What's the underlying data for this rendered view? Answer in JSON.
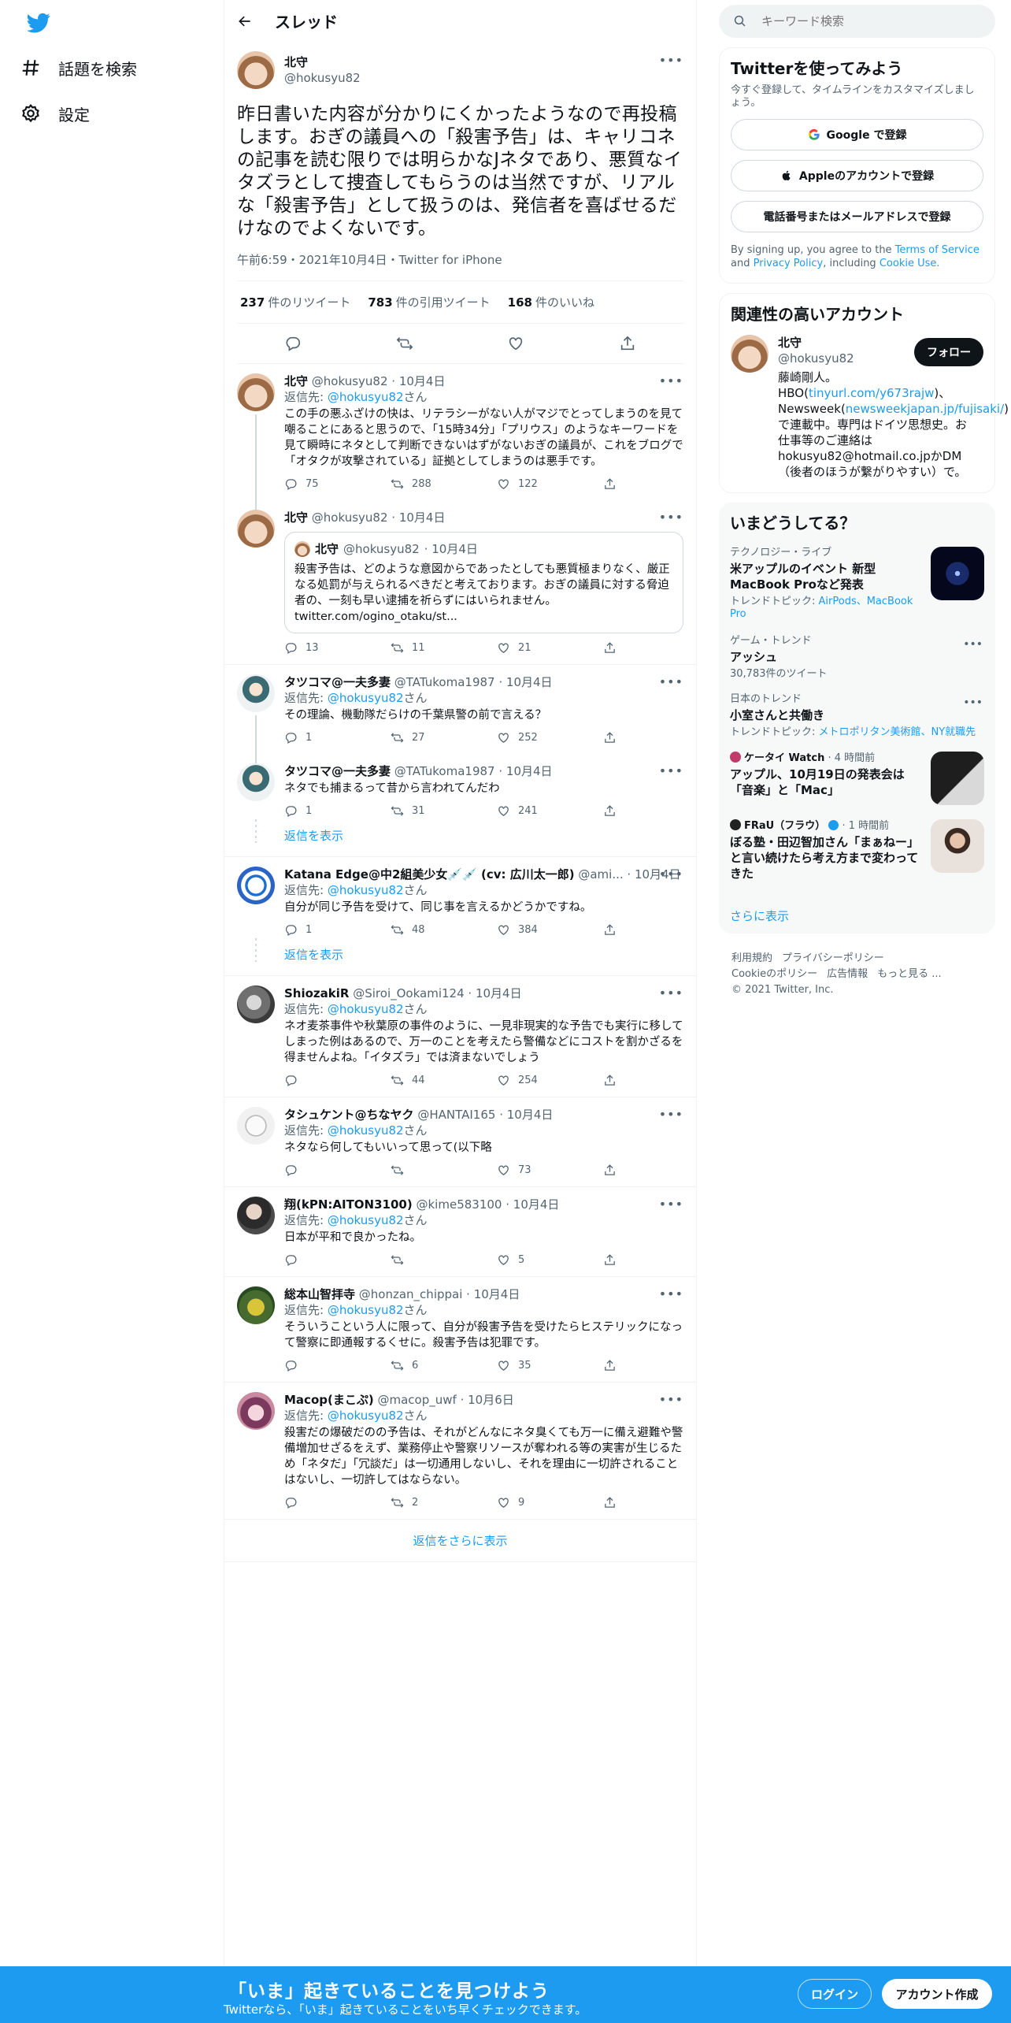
{
  "nav": {
    "explore_label": "話題を検索",
    "settings_label": "設定"
  },
  "header": {
    "title": "スレッド"
  },
  "focus": {
    "name": "北守",
    "handle": "@hokusyu82",
    "text": "昨日書いた内容が分かりにくかったようなので再投稿します。おぎの議員への「殺害予告」は、キャリコネの記事を読む限りでは明らかなJネタであり、悪質なイタズラとして捜査してもらうのは当然ですが、リアルな「殺害予告」として扱うのは、発信者を喜ばせるだけなのでよくないです。",
    "meta": "午前6:59・2021年10月4日・Twitter for iPhone",
    "retweets": "237",
    "retweets_label": "件のリツイート",
    "quotes": "783",
    "quotes_label": "件の引用ツイート",
    "likes": "168",
    "likes_label": "件のいいね"
  },
  "reply_prefix": "返信先:",
  "reply_target": "@hokusyu82",
  "reply_suffix": "さん",
  "tweets": [
    {
      "name": "北守",
      "handle": "@hokusyu82",
      "date": "10月4日",
      "has_reply": true,
      "text": "この手の悪ふざけの快は、リテラシーがない人がマジでとってしまうのを見て嘲ることにあると思うので、「15時34分」「プリウス」のようなキーワードを見て瞬時にネタとして判断できないはずがないおぎの議員が、これをブログで「オタクが攻撃されている」証拠としてしまうのは悪手です。",
      "replies": "75",
      "retweets": "288",
      "likes": "122"
    },
    {
      "name": "北守",
      "handle": "@hokusyu82",
      "date": "10月4日",
      "has_reply": false,
      "quote": {
        "name": "北守",
        "handle": "@hokusyu82",
        "date": "· 10月4日",
        "text": "殺害予告は、どのような意図からであったとしても悪質極まりなく、厳正なる処罰が与えられるべきだと考えております。おぎの議員に対する脅迫者の、一刻も早い逮捕を祈らずにはいられません。",
        "link": "twitter.com/ogino_otaku/st..."
      },
      "replies": "13",
      "retweets": "11",
      "likes": "21"
    },
    {
      "name": "タツコマ@一夫多妻",
      "handle": "@TATukoma1987",
      "date": "10月4日",
      "has_reply": true,
      "text": "その理論、機動隊だらけの千葉県警の前で言える？",
      "replies": "1",
      "retweets": "27",
      "likes": "252"
    },
    {
      "name": "タツコマ@一夫多妻",
      "handle": "@TATukoma1987",
      "date": "10月4日",
      "has_reply": false,
      "text": "ネタでも捕まるって昔から言われてんだわ",
      "replies": "1",
      "retweets": "31",
      "likes": "241"
    },
    {
      "name": "Katana Edge@中2組美少女💉💉 (cv: 広川太一郎)",
      "handle": "@ami...",
      "date": "10月4日",
      "has_reply": true,
      "text": "自分が同じ予告を受けて、同じ事を言えるかどうかですね。",
      "replies": "1",
      "retweets": "48",
      "likes": "384"
    },
    {
      "name": "ShiozakiR",
      "handle": "@Siroi_Ookami124",
      "date": "10月4日",
      "has_reply": true,
      "text": "ネオ麦茶事件や秋葉原の事件のように、一見非現実的な予告でも実行に移してしまった例はあるので、万一のことを考えたら警備などにコストを割かざるを得ませんよね。「イタズラ」では済まないでしょう",
      "replies": "",
      "retweets": "44",
      "likes": "254"
    },
    {
      "name": "タシュケント@ちなヤク",
      "handle": "@HANTAI165",
      "date": "10月4日",
      "has_reply": true,
      "text": "ネタなら何してもいいって思って(以下略",
      "replies": "",
      "retweets": "",
      "likes": "73"
    },
    {
      "name": "翔(kPN:AITON3100)",
      "handle": "@kime583100",
      "date": "10月4日",
      "has_reply": true,
      "text": "日本が平和で良かったね。",
      "replies": "",
      "retweets": "",
      "likes": "5"
    },
    {
      "name": "総本山智拝寺",
      "handle": "@honzan_chippai",
      "date": "10月4日",
      "has_reply": true,
      "text": "そういうこという人に限って、自分が殺害予告を受けたらヒステリックになって警察に即通報するくせに。殺害予告は犯罪です。",
      "replies": "",
      "retweets": "6",
      "likes": "35"
    },
    {
      "name": "Macop(まこぷ)",
      "handle": "@macop_uwf",
      "date": "10月6日",
      "has_reply": true,
      "text": "殺害だの爆破だのの予告は、それがどんなにネタ臭くても万一に備え避難や警備増加せざるをえず、業務停止や警察リソースが奪われる等の実害が生じるため「ネタだ」「冗談だ」は一切通用しないし、それを理由に一切許されることはないし、一切許してはならない。",
      "replies": "",
      "retweets": "2",
      "likes": "9"
    }
  ],
  "show_replies_label": "返信を表示",
  "show_more_replies": "返信をさらに表示",
  "sidebar": {
    "search_placeholder": "キーワード検索",
    "signup": {
      "title": "Twitterを使ってみよう",
      "subtitle": "今すぐ登録して、タイムラインをカスタマイズしましょう。",
      "google": "Google で登録",
      "apple": "Appleのアカウントで登録",
      "phone": "電話番号またはメールアドレスで登録",
      "legal_1": "By signing up, you agree to the",
      "terms": "Terms of Service",
      "legal_and": "and",
      "privacy": "Privacy Policy",
      "legal_including": ", including",
      "cookie": "Cookie Use."
    },
    "relevant": {
      "title": "関連性の高いアカウント",
      "name": "北守",
      "handle": "@hokusyu82",
      "follow": "フォロー",
      "bio_1": "藤崎剛人。HBO(",
      "bio_link1": "tinyurl.com/y673rajw",
      "bio_2": ")、Newsweek(",
      "bio_link2": "newsweekjapan.jp/fujisaki/",
      "bio_3": ")で連載中。専門はドイツ思想史。お仕事等のご連絡はhokusyu82@hotmail.co.jpかDM（後者のほうが繋がりやすい）で。"
    },
    "trends": {
      "title": "いまどうしてる？",
      "items": [
        {
          "category": "テクノロジー・ライブ",
          "title": "米アップルのイベント 新型MacBook Proなど発表",
          "sub_label": "トレンドトピック: ",
          "sub_links": "AirPods、MacBook Pro"
        },
        {
          "category": "ゲーム・トレンド",
          "title": "アッシュ",
          "sub": "30,783件のツイート"
        },
        {
          "category": "日本のトレンド",
          "title": "小室さんと共働き",
          "sub_label": "トレンドトピック: ",
          "sub_links": "メトロポリタン美術館、NY就職先"
        },
        {
          "source": "ケータイ Watch",
          "time": "· 4 時間前",
          "title": "アップル、10月19日の発表会は「音楽」と「Mac」"
        },
        {
          "source": "FRaU（フラウ）",
          "time": "· 1 時間前",
          "title": "ぼる塾・田辺智加さん「まぁねー」と言い続けたら考え方まで変わってきた"
        }
      ],
      "show_more": "さらに表示"
    },
    "footer": {
      "links": [
        "利用規約",
        "プライバシーポリシー",
        "Cookieのポリシー",
        "広告情報",
        "もっと見る ..."
      ],
      "copyright": "© 2021 Twitter, Inc."
    }
  },
  "bottom": {
    "title": "「いま」起きていることを見つけよう",
    "subtitle": "Twitterなら、「いま」起きていることをいち早くチェックできます。",
    "login": "ログイン",
    "signup": "アカウント作成"
  },
  "colors": {
    "accent": "#1d9bf0",
    "text": "#0f1419",
    "muted": "#536471"
  }
}
